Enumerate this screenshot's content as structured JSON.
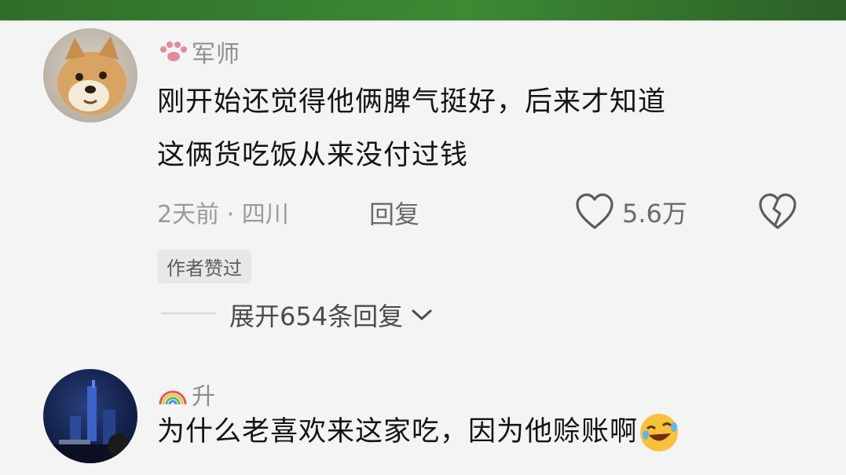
{
  "comments": [
    {
      "username": "军师",
      "text_lines": [
        "刚开始还觉得他俩脾气挺好，后来才知道",
        "这俩货吃饭从来没付过钱"
      ],
      "meta": "2天前 · 四川",
      "reply_label": "回复",
      "likes": "5.6万",
      "author_liked": "作者赞过",
      "expand_replies": "展开654条回复",
      "avatar_icon": "shiba-dog-avatar",
      "badge_icon": "paw-badge-icon"
    },
    {
      "username": "升",
      "text": "为什么老喜欢来这家吃，因为他赊账啊",
      "avatar_icon": "night-city-avatar",
      "badge_icon": "rainbow-icon",
      "emoji": "rolling-laughing-emoji"
    }
  ],
  "colors": {
    "background": "#f4f4f4",
    "text": "#141414",
    "muted": "#9a9a9a",
    "top_strip": "#3c8a34"
  }
}
